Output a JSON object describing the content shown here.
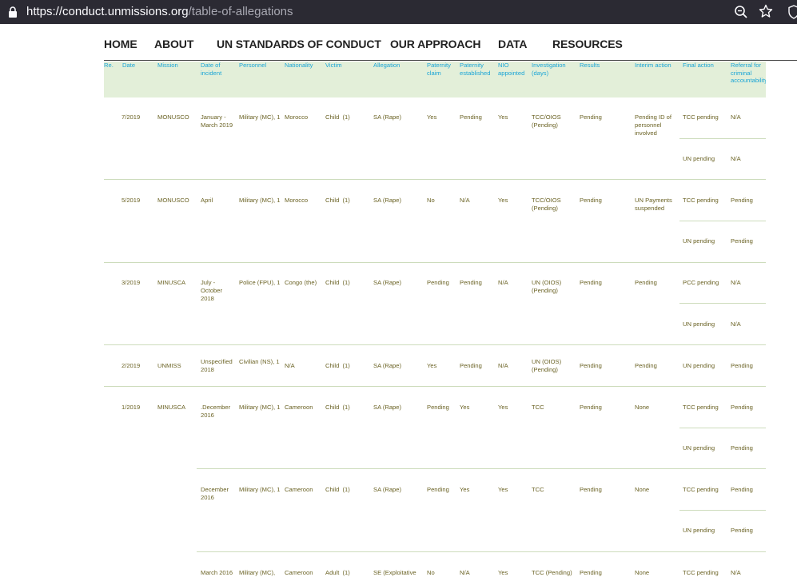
{
  "browser": {
    "url_host": "https://conduct.unmissions.org",
    "url_path": "/table-of-allegations"
  },
  "nav": {
    "items": [
      "HOME",
      "ABOUT",
      "UN STANDARDS OF CONDUCT",
      "OUR APPROACH",
      "DATA",
      "RESOURCES"
    ]
  },
  "table": {
    "headers": {
      "ref": "Re.",
      "date": "Date",
      "mission": "Mission",
      "date_of_incident": "Date of incident",
      "personnel": "Personnel",
      "nationality": "Nationality",
      "victim": "Victim",
      "allegation": "Allegation",
      "paternity_claim": "Paternity claim",
      "paternity_established": "Paternity established",
      "nio_appointed": "NIO appointed",
      "investigation": "Investigation (days)",
      "results": "Results",
      "interim_action": "Interim action",
      "final_action": "Final action",
      "referral": "Referral for criminal accountability"
    },
    "rows": [
      {
        "date": "7/2019",
        "mission": "MONUSCO",
        "date_of_incident": "January - March 2019",
        "personnel": "Military (MC), 1",
        "nationality": "Morocco",
        "victim": "Child  (1)",
        "allegation": "SA (Rape)",
        "paternity_claim": "Yes",
        "paternity_established": "Pending",
        "nio_appointed": "Yes",
        "investigation": "TCC/OIOS (Pending)",
        "results": "Pending",
        "interim_action": "Pending ID of personnel involved",
        "final_1": "TCC pending",
        "referral_1": "N/A",
        "final_2": "UN pending",
        "referral_2": "N/A"
      },
      {
        "date": "5/2019",
        "mission": "MONUSCO",
        "date_of_incident": "April",
        "personnel": "Military (MC), 1",
        "nationality": "Morocco",
        "victim": "Child  (1)",
        "allegation": "SA (Rape)",
        "paternity_claim": "No",
        "paternity_established": "N/A",
        "nio_appointed": "Yes",
        "investigation": "TCC/OIOS (Pending)",
        "results": "Pending",
        "interim_action": "UN Payments suspended",
        "final_1": "TCC pending",
        "referral_1": "Pending",
        "final_2": "UN pending",
        "referral_2": "Pending"
      },
      {
        "date": "3/2019",
        "mission": "MINUSCA",
        "date_of_incident": "July - October 2018",
        "personnel": "Police (FPU), 1",
        "nationality": "Congo (the)",
        "victim": "Child  (1)",
        "allegation": "SA (Rape)",
        "paternity_claim": "Pending",
        "paternity_established": "Pending",
        "nio_appointed": "N/A",
        "investigation": "UN (OIOS) (Pending)",
        "results": "Pending",
        "interim_action": "Pending",
        "final_1": "PCC pending",
        "referral_1": "N/A",
        "final_2": "UN pending",
        "referral_2": "N/A"
      },
      {
        "date": "2/2019",
        "mission": "UNMISS",
        "date_of_incident": "Unspecified 2018",
        "personnel": "Civilian (NS), 1",
        "nationality": "N/A",
        "victim": "Child  (1)",
        "allegation": "SA (Rape)",
        "paternity_claim": "Yes",
        "paternity_established": "Pending",
        "nio_appointed": "N/A",
        "investigation": "UN (OIOS) (Pending)",
        "results": "Pending",
        "interim_action": "Pending",
        "final_1": "UN pending",
        "referral_1": "Pending"
      },
      {
        "date": "1/2019",
        "mission": "MINUSCA",
        "date_of_incident": ".December 2016",
        "personnel": "Military (MC), 1",
        "nationality": "Cameroon",
        "victim": "Child  (1)",
        "allegation": "SA (Rape)",
        "paternity_claim": "Pending",
        "paternity_established": "Yes",
        "nio_appointed": "Yes",
        "investigation": "TCC",
        "results": "Pending",
        "interim_action": "None",
        "final_1": "TCC pending",
        "referral_1": "Pending",
        "final_2": "UN pending",
        "referral_2": "Pending"
      },
      {
        "date_of_incident": "December 2016",
        "personnel": "Military (MC), 1",
        "nationality": "Cameroon",
        "victim": "Child  (1)",
        "allegation": "SA (Rape)",
        "paternity_claim": "Pending",
        "paternity_established": "Yes",
        "nio_appointed": "Yes",
        "investigation": "TCC",
        "results": "Pending",
        "interim_action": "None",
        "final_1": "TCC pending",
        "referral_1": "Pending",
        "final_2": "UN pending",
        "referral_2": "Pending"
      },
      {
        "date_of_incident": "March 2016",
        "personnel": "Military (MC),",
        "nationality": "Cameroon",
        "victim": "Adult  (1)",
        "allegation": "SE (Exploitative",
        "paternity_claim": "No",
        "paternity_established": "N/A",
        "nio_appointed": "Yes",
        "investigation": "TCC (Pending)",
        "results": "Pending",
        "interim_action": "None",
        "final_1": "TCC pending",
        "referral_1": "N/A"
      }
    ]
  },
  "colors": {
    "header_bg": "#e3efd9",
    "header_text": "#1aa5d6",
    "cell_text": "#6b6325",
    "row_line": "#cddcbc",
    "browser_bar": "#2b2a33"
  },
  "icons": [
    "lock-icon",
    "zoom-icon",
    "bookmark-star-icon",
    "shield-icon"
  ]
}
